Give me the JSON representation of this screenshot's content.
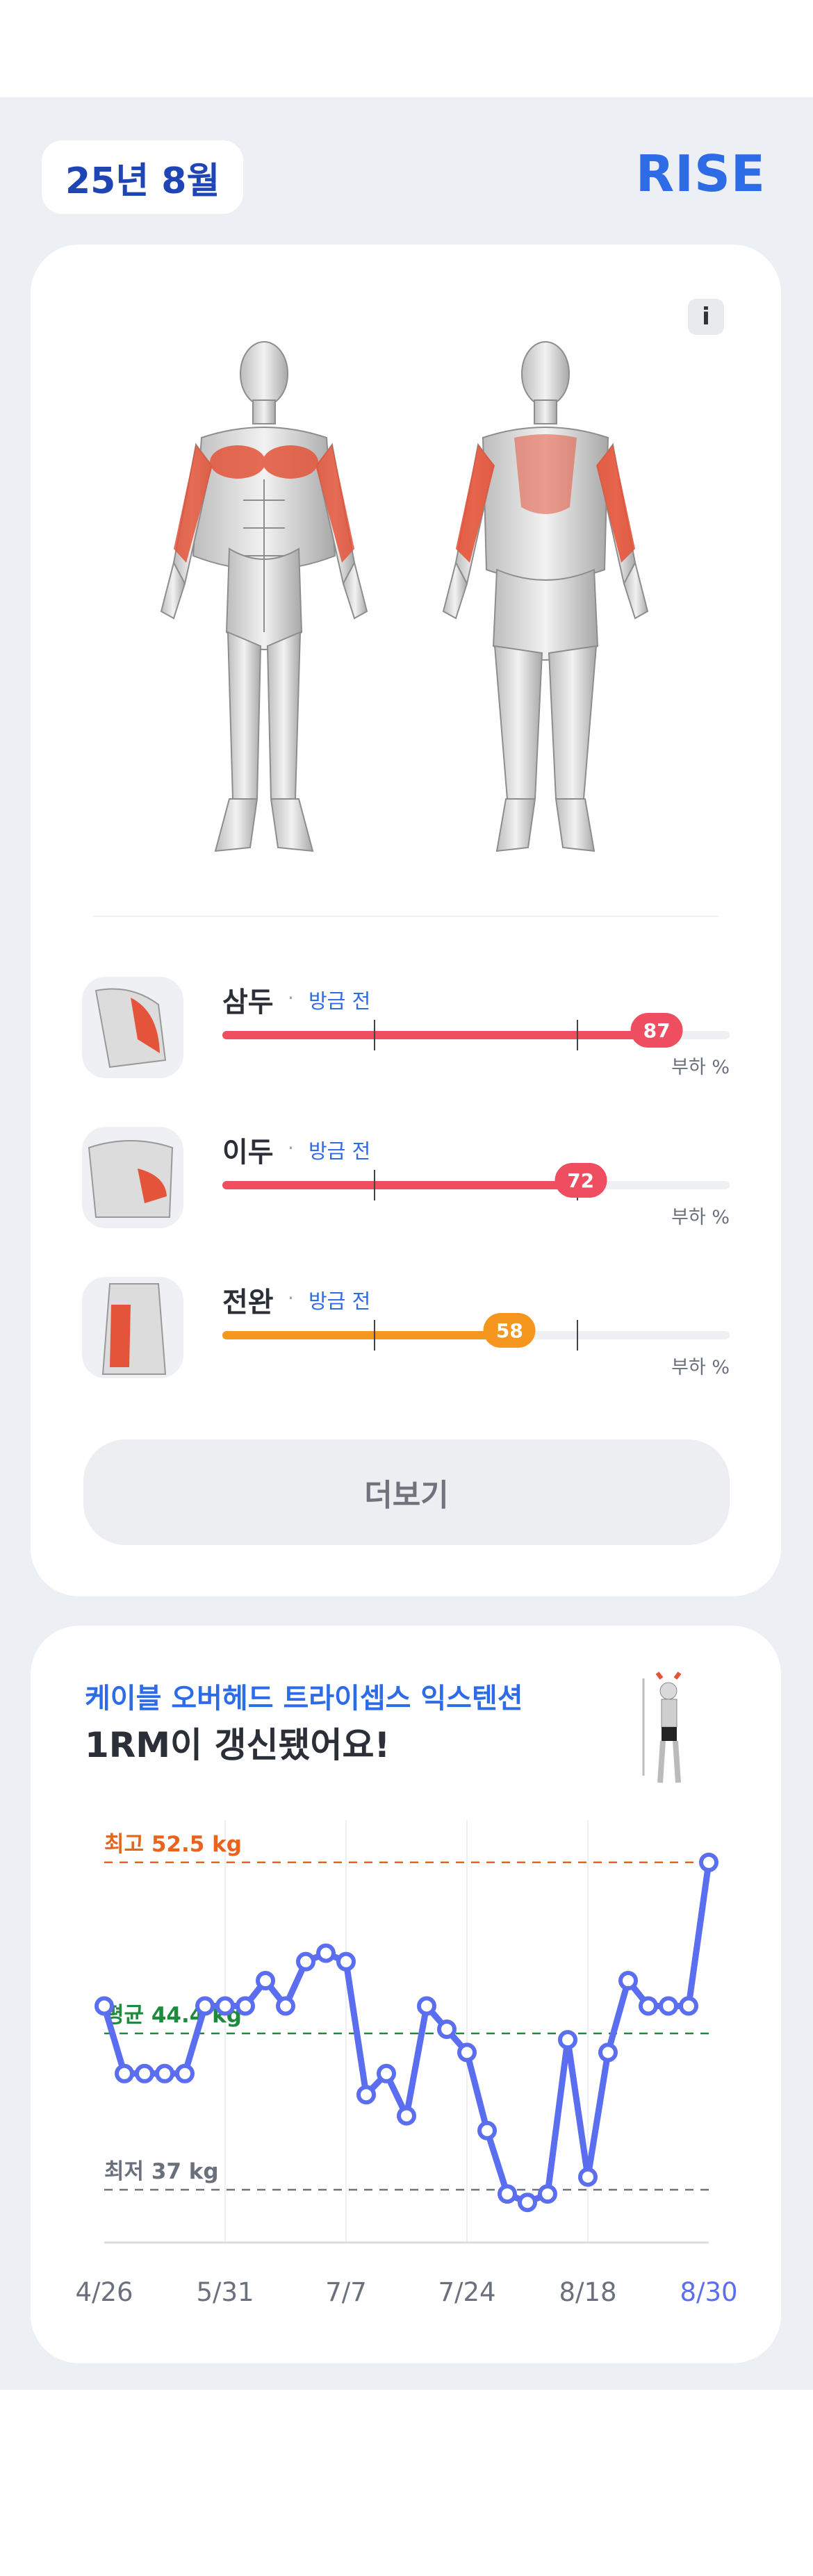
{
  "header": {
    "date": "25년 8월",
    "brand": "RISE"
  },
  "body_map": {
    "info_label": "i"
  },
  "muscles": [
    {
      "name": "삼두",
      "status": "방금 전",
      "load": 87,
      "unit_label": "부하 %",
      "color": "#ef4d60"
    },
    {
      "name": "이두",
      "status": "방금 전",
      "load": 72,
      "unit_label": "부하 %",
      "color": "#ef4d60"
    },
    {
      "name": "전완",
      "status": "방금 전",
      "load": 58,
      "unit_label": "부하 %",
      "color": "#f5961f"
    }
  ],
  "more_button": "더보기",
  "record": {
    "exercise": "케이블 오버헤드 트라이셉스 익스텐션",
    "headline": "1RM이 갱신됐어요!"
  },
  "chart_data": {
    "type": "line",
    "x_ticks": [
      "4/26",
      "5/31",
      "7/7",
      "7/24",
      "8/18",
      "8/30"
    ],
    "highlight_tick": "8/30",
    "reference_lines": [
      {
        "label": "최고 52.5 kg",
        "value": 52.5,
        "color": "#e8641e"
      },
      {
        "label": "평균 44.4 kg",
        "value": 44.4,
        "color": "#1e8a3c"
      },
      {
        "label": "최저 37 kg",
        "value": 37,
        "color": "#6b717c"
      }
    ],
    "series": [
      {
        "values": [
          45.7,
          42.5,
          42.5,
          42.5,
          42.5,
          45.7,
          45.7,
          45.7,
          46.9,
          45.7,
          47.8,
          48.2,
          47.8,
          41.5,
          42.5,
          40.5,
          45.7,
          44.6,
          43.5,
          39.8,
          36.8,
          36.4,
          36.8,
          44.1,
          37.6,
          43.5,
          46.9,
          45.7,
          45.7,
          45.7,
          52.5
        ]
      }
    ],
    "ylim": [
      34.5,
      54.5
    ],
    "line_color": "#5b6ef0",
    "grid": true
  },
  "colors": {
    "accent": "#2e6be6",
    "background": "#eceff3",
    "highlight_muscle": "#e4543a"
  }
}
